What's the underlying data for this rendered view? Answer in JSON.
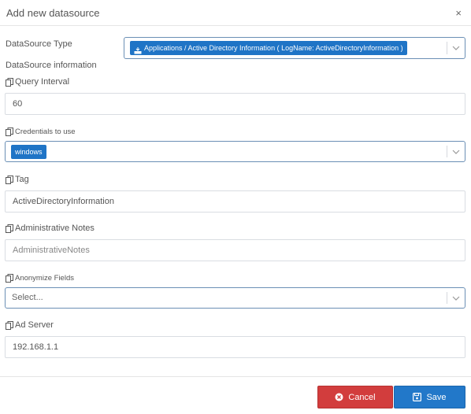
{
  "header": {
    "title": "Add new datasource",
    "close_label": "×"
  },
  "datasource_type": {
    "label": "DataSource Type",
    "value": "Applications / Active Directory Information ( LogName: ActiveDirectoryInformation )"
  },
  "section_heading": "DataSource information",
  "query_interval": {
    "label": "Query Interval",
    "value": "60"
  },
  "credentials": {
    "label": "Credentials to use",
    "value": "windows"
  },
  "tag": {
    "label": "Tag",
    "value": "ActiveDirectoryInformation"
  },
  "admin_notes": {
    "label": "Administrative Notes",
    "placeholder": "AdministrativeNotes"
  },
  "anonymize": {
    "label": "Anonymize Fields",
    "placeholder": "Select..."
  },
  "ad_server": {
    "label": "Ad Server",
    "value": "192.168.1.1"
  },
  "buttons": {
    "cancel": "Cancel",
    "save": "Save"
  },
  "colors": {
    "primary": "#2278c9",
    "danger": "#d23d3d",
    "chip": "#1f74c6"
  }
}
